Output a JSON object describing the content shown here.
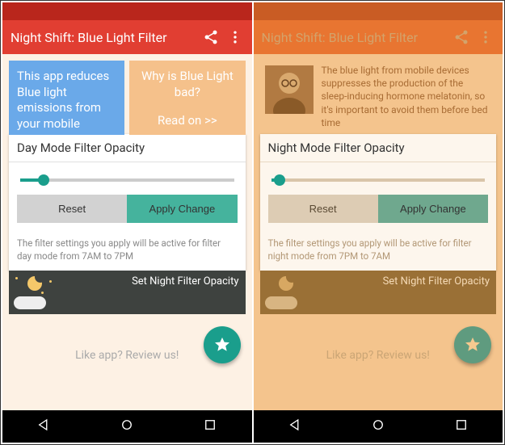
{
  "left": {
    "app_title": "Night Shift: Blue Light Filter",
    "info1": "This app reduces Blue light emissions from your mobile",
    "info2_title": "Why is Blue Light bad?",
    "info2_link": "Read on >>",
    "card_title": "Day Mode Filter Opacity",
    "slider_pct": 11,
    "reset_label": "Reset",
    "apply_label": "Apply Change",
    "help_text": "The filter settings you apply will be active for filter day mode from 7AM to 7PM",
    "night_label": "Set Night Filter Opacity",
    "review_text": "Like app? Review us!"
  },
  "right": {
    "app_title": "Night Shift: Blue Light Filter",
    "info_text": "The blue light from mobile devices suppresses the production of the sleep-inducing hormone melatonin, so it's important to avoid them before bed time",
    "card_title": "Night Mode Filter Opacity",
    "slider_pct": 4,
    "reset_label": "Reset",
    "apply_label": "Apply Change",
    "help_text": "The filter settings you apply will be active for filter night mode from 7PM to 7AM",
    "night_label": "Set Night Filter Opacity",
    "review_text": "Like app? Review us!"
  }
}
